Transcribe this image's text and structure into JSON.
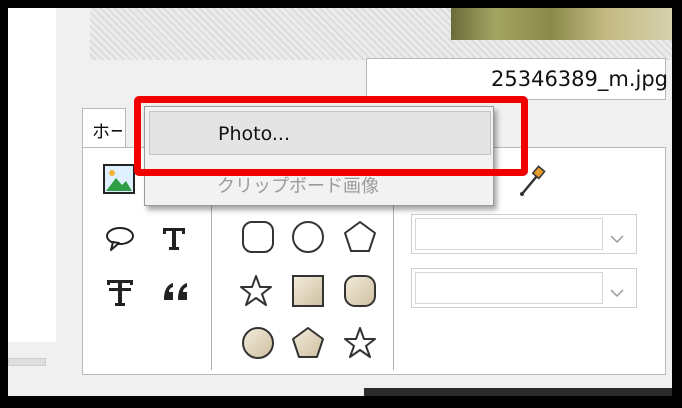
{
  "document": {
    "filename": "25346389_m.jpg",
    "ribbon_tab_label": "ホーム"
  },
  "context_menu": {
    "items": [
      {
        "label": "Photo...",
        "enabled": true,
        "highlighted": true
      },
      {
        "label": "クリップボード画像",
        "enabled": false
      }
    ]
  },
  "tools": {
    "row1": [
      "insert-image-icon",
      "eyedropper-icon"
    ],
    "row2": [
      "speech-bubble-icon",
      "text-icon",
      "rounded-square-icon",
      "circle-icon",
      "pentagon-icon"
    ],
    "row3": [
      "vertical-text-icon",
      "quote-icon",
      "star-outline-icon",
      "square-filled-icon",
      "octagon-filled-icon"
    ],
    "row4": [
      "circle-filled-icon",
      "pentagon-filled-icon",
      "star-outline-small-icon"
    ]
  },
  "dropdowns": [
    {
      "value": ""
    },
    {
      "value": ""
    }
  ],
  "colors": {
    "highlight": "#f00000",
    "shape_fill": "#e6dcc7"
  }
}
